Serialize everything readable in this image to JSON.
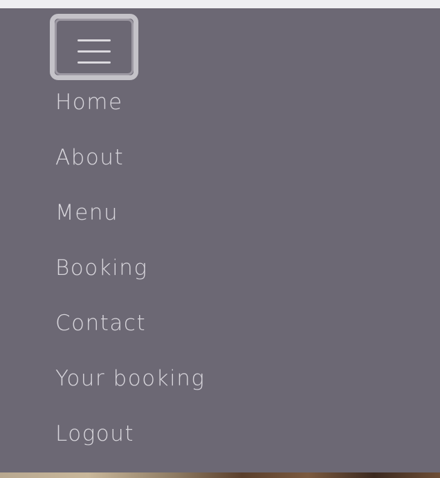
{
  "navbar": {
    "toggler": {
      "icon": "hamburger-icon"
    },
    "items": [
      {
        "label": "Home"
      },
      {
        "label": "About"
      },
      {
        "label": "Menu"
      },
      {
        "label": "Booking"
      },
      {
        "label": "Contact"
      },
      {
        "label": "Your booking"
      },
      {
        "label": "Logout"
      }
    ]
  },
  "colors": {
    "panel_bg": "#6c6874",
    "link_text": "#d8d6dc",
    "toggler_border": "#c4c2c8"
  }
}
